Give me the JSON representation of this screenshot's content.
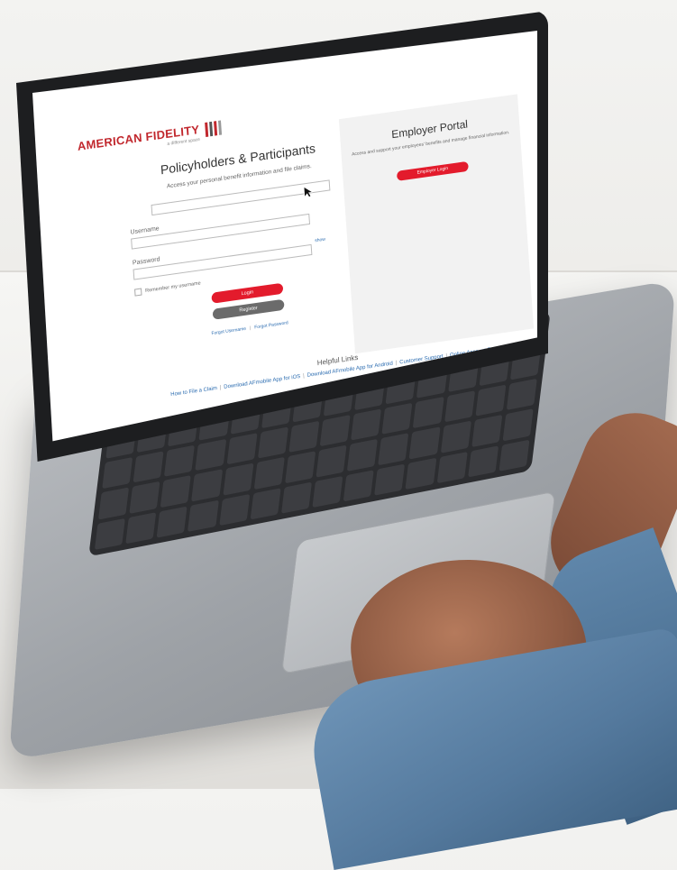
{
  "brand": {
    "name": "AMERICAN FIDELITY",
    "tagline": "a different space"
  },
  "policyholders": {
    "heading": "Policyholders & Participants",
    "subtext": "Access your personal benefit information and file claims.",
    "username_label": "Username",
    "password_label": "Password",
    "show_label": "show",
    "remember_label": "Remember my username",
    "login_label": "Login",
    "register_label": "Register",
    "forgot_username": "Forgot Username",
    "forgot_password": "Forgot Password"
  },
  "employer": {
    "heading": "Employer Portal",
    "subtext": "Access and support your employees' benefits and manage financial information.",
    "login_label": "Employer Login"
  },
  "helpful": {
    "title": "Helpful Links",
    "links": [
      "How to File a Claim",
      "Download AFmobile App for iOS",
      "Download AFmobile App for Android",
      "Customer Support",
      "Online Account Support"
    ]
  },
  "colors": {
    "brand_red": "#c1272d",
    "button_red": "#e31b2c",
    "button_gray": "#6b6b6b",
    "link_blue": "#2b6cb0"
  }
}
